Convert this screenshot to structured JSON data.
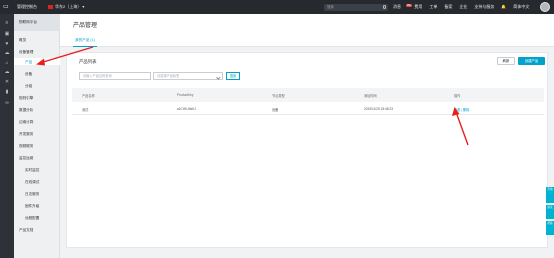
{
  "topbar": {
    "home_label": "管理控制台",
    "region_label": "华东2（上海）",
    "search_placeholder": "搜索",
    "nav": [
      "消息",
      "费用",
      "工单",
      "备案",
      "企业",
      "支持与服务",
      "",
      "简体中文"
    ],
    "message_badge": "99+"
  },
  "sidebar": {
    "title": "物联网平台",
    "items": [
      {
        "label": "概览"
      },
      {
        "label": "设备管理"
      },
      {
        "label": "产品"
      },
      {
        "label": "设备"
      },
      {
        "label": "分组"
      },
      {
        "label": "规则引擎"
      },
      {
        "label": "数据分析"
      },
      {
        "label": "边缘计算"
      },
      {
        "label": "开发服务"
      },
      {
        "label": "视频服务"
      },
      {
        "label": "监控运维"
      },
      {
        "label": "实时监控"
      },
      {
        "label": "在线调试"
      },
      {
        "label": "日志服务"
      },
      {
        "label": "固件升级"
      },
      {
        "label": "远程配置"
      },
      {
        "label": "产品文档"
      }
    ]
  },
  "page": {
    "title": "产品管理",
    "tab_label": "我的产品 (1)"
  },
  "card": {
    "title": "产品列表",
    "refresh_label": "刷新",
    "create_label": "创建产品",
    "search_placeholder": "请输入产品名称查询",
    "filter_placeholder": "请选择产品标签",
    "search_button": "搜索"
  },
  "table": {
    "headers": [
      "产品名称",
      "ProductKey",
      "节点类型",
      "添加时间",
      "操作"
    ],
    "rows": [
      {
        "name": "测试",
        "key": "a1CHKJbkKJ",
        "node_type": "设备",
        "added": "2019/11/25 15:48:23",
        "actions": "查看 | 删除"
      }
    ]
  },
  "float_tools": [
    "咨询",
    "建议",
    "帮助"
  ]
}
